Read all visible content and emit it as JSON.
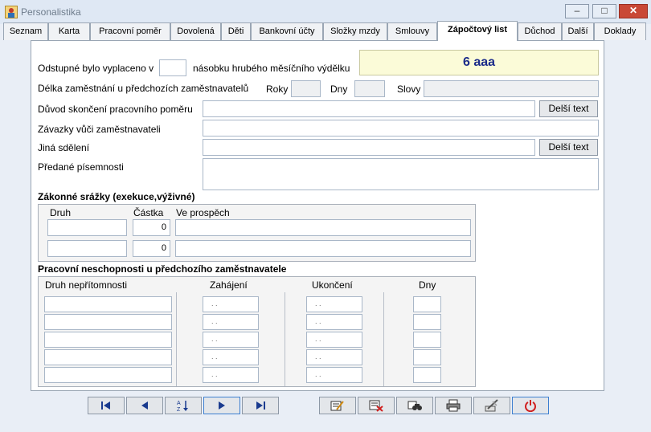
{
  "window": {
    "title": "Personalistika",
    "min": "‒",
    "max": "□",
    "close": "✕"
  },
  "tabs": [
    {
      "label": "Seznam"
    },
    {
      "label": "Karta"
    },
    {
      "label": "Pracovní poměr"
    },
    {
      "label": "Dovolená"
    },
    {
      "label": "Děti"
    },
    {
      "label": "Bankovní účty"
    },
    {
      "label": "Složky mzdy"
    },
    {
      "label": "Smlouvy"
    },
    {
      "label": "Zápočtový list"
    },
    {
      "label": "Důchod"
    },
    {
      "label": "Další"
    },
    {
      "label": "Doklady"
    }
  ],
  "form": {
    "severance_prefix": "Odstupné bylo vyplaceno v",
    "severance_suffix": "násobku hrubého měsíčního výdělku",
    "severance_value": "",
    "highlight": "6  aaa",
    "employment_length_label": "Délka zaměstnání u předchozích zaměstnavatelů",
    "years_label": "Roky",
    "days_label": "Dny",
    "words_label": "Slovy",
    "termination_reason_label": "Důvod skončení pracovního poměru",
    "obligations_label": "Závazky vůči zaměstnavateli",
    "other_notices_label": "Jiná sdělení",
    "handed_docs_label": "Předané písemnosti",
    "longer_text_button": "Delší text"
  },
  "deductions": {
    "title": "Zákonné srážky (exekuce,výživné)",
    "headers": {
      "type": "Druh",
      "amount": "Částka",
      "beneficiary": "Ve prospěch"
    },
    "rows": [
      {
        "type": "",
        "amount": "0",
        "beneficiary": ""
      },
      {
        "type": "",
        "amount": "0",
        "beneficiary": ""
      }
    ]
  },
  "incapacity": {
    "title": "Pracovní neschopnosti u předchozího zaměstnavatele",
    "headers": {
      "type": "Druh nepřítomnosti",
      "start": "Zahájení",
      "end": "Ukončení",
      "days": "Dny"
    },
    "date_placeholder": ". .",
    "rows": [
      {
        "type": "",
        "start": ". .",
        "end": ". .",
        "days": ""
      },
      {
        "type": "",
        "start": ". .",
        "end": ". .",
        "days": ""
      },
      {
        "type": "",
        "start": ". .",
        "end": ". .",
        "days": ""
      },
      {
        "type": "",
        "start": ". .",
        "end": ". .",
        "days": ""
      },
      {
        "type": "",
        "start": ". .",
        "end": ". .",
        "days": ""
      }
    ]
  },
  "toolbar": {
    "icons": [
      "first-record-icon",
      "previous-record-icon",
      "sort-icon",
      "next-record-icon",
      "last-record-icon",
      "edit-record-icon",
      "delete-record-icon",
      "search-binoculars-icon",
      "print-icon",
      "tools-icon",
      "power-icon"
    ]
  }
}
